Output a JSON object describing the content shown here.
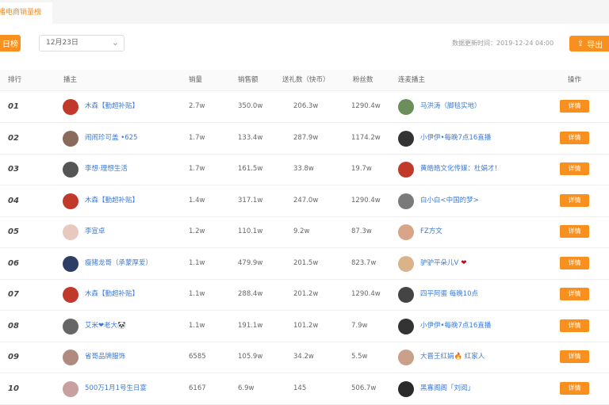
{
  "tabs": {
    "active_label": "播电商销量榜"
  },
  "toolbar": {
    "day_button": "日榜",
    "date_value": "12月23日",
    "update_time": "数据更新时间：2019-12-24 04:00",
    "export_label": "导出"
  },
  "table": {
    "headers": {
      "rank": "排行",
      "anchor": "播主",
      "sales": "销量",
      "revenue": "销售额",
      "gifts": "送礼数（快币）",
      "fans": "粉丝数",
      "mic": "连麦播主",
      "action": "操作"
    },
    "rows": [
      {
        "rank": "01",
        "anchor": "木森【勤超补贴】",
        "sales": "2.7w",
        "revenue": "350.0w",
        "gifts": "206.3w",
        "fans": "1290.4w",
        "mic": "马洪涛（脚毯实地）",
        "action": "详情",
        "avatar_color": "#c0392b",
        "mic_color": "#6b8e5a"
      },
      {
        "rank": "02",
        "anchor": "闹闹珍可盖 •625",
        "sales": "1.7w",
        "revenue": "133.4w",
        "gifts": "287.9w",
        "fans": "1174.2w",
        "mic": "小伊伊•每晚7点16直播",
        "action": "详情",
        "avatar_color": "#8a6a5a",
        "mic_color": "#333333"
      },
      {
        "rank": "03",
        "anchor": "李想·理想生活",
        "sales": "1.7w",
        "revenue": "161.5w",
        "gifts": "33.8w",
        "fans": "19.7w",
        "mic": "黄皓皓文化传媒：杜娟才！",
        "action": "详情",
        "avatar_color": "#555555",
        "mic_color": "#c0392b"
      },
      {
        "rank": "04",
        "anchor": "木森【勤超补贴】",
        "sales": "1.4w",
        "revenue": "317.1w",
        "gifts": "247.0w",
        "fans": "1290.4w",
        "mic": "白小白<中国的梦>",
        "action": "详情",
        "avatar_color": "#c0392b",
        "mic_color": "#7a7a7a"
      },
      {
        "rank": "05",
        "anchor": "李宣卓",
        "sales": "1.2w",
        "revenue": "110.1w",
        "gifts": "9.2w",
        "fans": "87.3w",
        "mic": "FZ方文",
        "action": "详情",
        "avatar_color": "#e8c9c0",
        "mic_color": "#d9a58a"
      },
      {
        "rank": "06",
        "anchor": "瘦猪龙哥（承蒙厚爱）",
        "sales": "1.1w",
        "revenue": "479.9w",
        "gifts": "201.5w",
        "fans": "823.7w",
        "mic": "驴驴平朵儿V",
        "action": "详情",
        "avatar_color": "#2c3e66",
        "mic_color": "#d9b48a",
        "mic_suffix": "❤"
      },
      {
        "rank": "07",
        "anchor": "木森【勤超补贴】",
        "sales": "1.1w",
        "revenue": "288.4w",
        "gifts": "201.2w",
        "fans": "1290.4w",
        "mic": "四平阿蛋 每晚10点",
        "action": "详情",
        "avatar_color": "#c0392b",
        "mic_color": "#444444"
      },
      {
        "rank": "08",
        "anchor": "艾米❤老大🐼",
        "sales": "1.1w",
        "revenue": "191.1w",
        "gifts": "101.2w",
        "fans": "7.9w",
        "mic": "小伊伊•每晚7点16直播",
        "action": "详情",
        "avatar_color": "#666666",
        "mic_color": "#333333"
      },
      {
        "rank": "09",
        "anchor": "省哥品牌服饰",
        "sales": "6585",
        "revenue": "105.9w",
        "gifts": "34.2w",
        "fans": "5.5w",
        "mic": "大晋王红娟🔥 红家人",
        "action": "详情",
        "avatar_color": "#b08a80",
        "mic_color": "#c9a08a"
      },
      {
        "rank": "10",
        "anchor": "500万1月1号生日宴",
        "sales": "6167",
        "revenue": "6.9w",
        "gifts": "145",
        "fans": "506.7w",
        "mic": "黑寡阁阁「刘阅」",
        "action": "详情",
        "avatar_color": "#c9a0a0",
        "mic_color": "#2a2a2a"
      }
    ]
  }
}
